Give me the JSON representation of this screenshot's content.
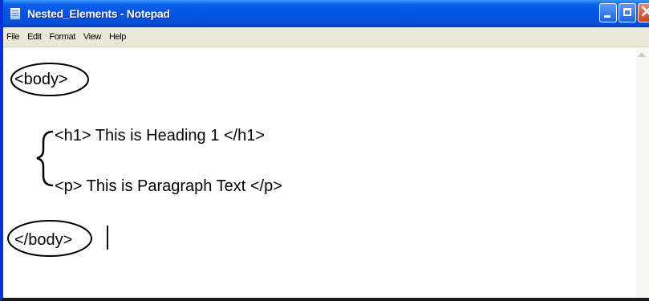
{
  "window": {
    "title": "Nested_Elements - Notepad",
    "icon": "notepad-icon",
    "controls": [
      "minimize-icon",
      "maximize-icon",
      "close-icon"
    ]
  },
  "menubar": {
    "items": [
      {
        "label": "File"
      },
      {
        "label": "Edit"
      },
      {
        "label": "Format"
      },
      {
        "label": "View"
      },
      {
        "label": "Help"
      }
    ]
  },
  "editor": {
    "lines": [
      "<body>",
      "<h1> This is Heading 1 </h1>",
      "<p> This is Paragraph Text </p>",
      "</body>"
    ]
  },
  "annotations": {
    "circle_color": "#000000",
    "brace_color": "#000000"
  },
  "colors": {
    "titlebar": "#0054e3",
    "menubar": "#ece9d8",
    "close_button": "#c94022"
  }
}
